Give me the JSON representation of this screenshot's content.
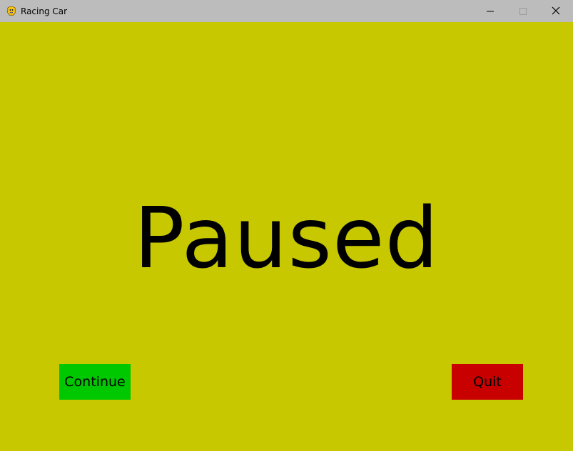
{
  "window": {
    "title": "Racing Car",
    "icon": "pygame-snake-icon",
    "controls": {
      "minimize_icon": "minimize-icon",
      "maximize_icon": "maximize-icon",
      "close_icon": "close-icon"
    }
  },
  "game": {
    "background_color": "#c8c800",
    "pause_screen": {
      "title": "Paused",
      "buttons": {
        "continue_label": "Continue",
        "continue_color": "#00c800",
        "quit_label": "Quit",
        "quit_color": "#c80000"
      }
    }
  }
}
